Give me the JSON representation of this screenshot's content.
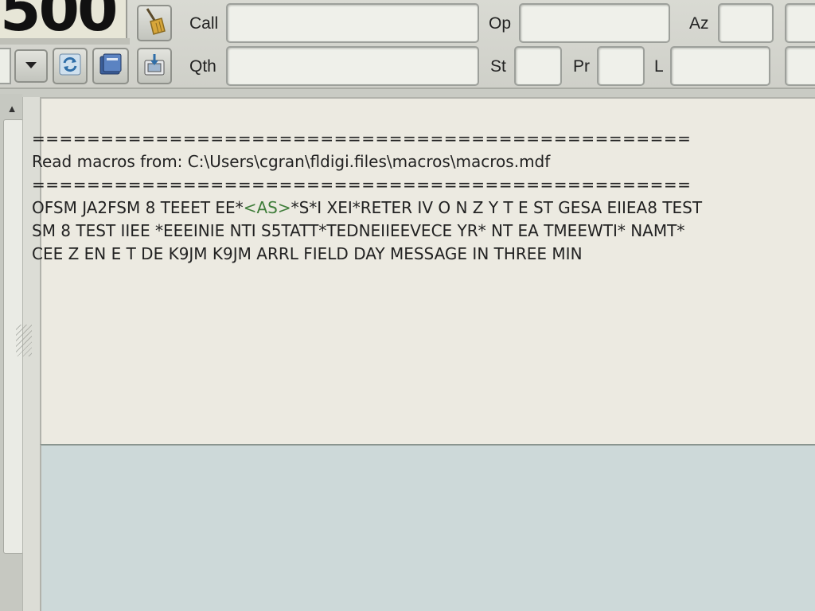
{
  "frequency": {
    "display": "500"
  },
  "toolbar": {
    "call_label": "Call",
    "op_label": "Op",
    "az_label": "Az",
    "qth_label": "Qth",
    "st_label": "St",
    "pr_label": "Pr",
    "l_label": "L",
    "call_value": "",
    "op_value": "",
    "az_value": "",
    "qth_value": "",
    "st_value": "",
    "pr_value": "",
    "l_value": ""
  },
  "icons": {
    "clear": "broom-icon",
    "dropdown": "chevron-down-icon",
    "refresh": "refresh-icon",
    "book": "logbook-icon",
    "save": "save-to-log-icon"
  },
  "rx_pane": {
    "rule_line": "================================================",
    "macro_line": "Read macros from: C:\\Users\\cgran\\fldigi.files\\macros\\macros.mdf",
    "decoded_line1_a": "OFSM JA2FSM 8 TEEET EE*",
    "decoded_line1_tag": "<AS>",
    "decoded_line1_b": "*S*I XEI*RETER IV O N Z Y T E ST GESA EIIEA8 TEST",
    "decoded_line2": "SM 8 TEST IIEE *EEEINIE NTI S5TATT*TEDNEIIEEVECE YR* NT EA TMEEWTI* NAMT*",
    "decoded_line3": "CEE Z EN E T DE K9JM K9JM ARRL FIELD DAY MESSAGE IN THREE MIN"
  },
  "colors": {
    "rx_background": "#eceae1",
    "tx_background": "#cdd9d9",
    "tag_green": "#3f7d3a"
  }
}
